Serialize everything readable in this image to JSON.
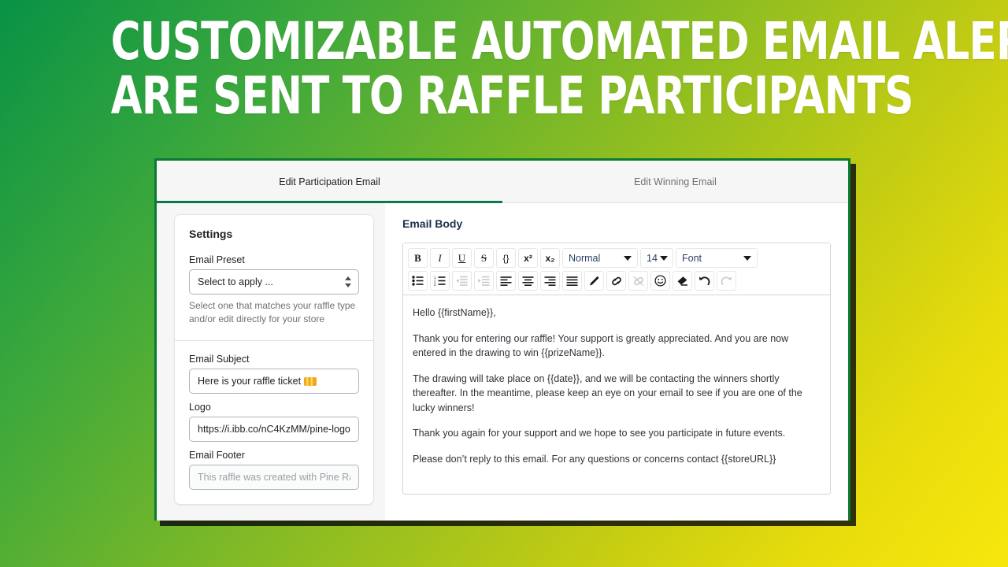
{
  "headline": {
    "line1": "CUSTOMIZABLE AUTOMATED EMAIL ALERTS",
    "line2": "ARE SENT TO RAFFLE PARTICIPANTS"
  },
  "theme": {
    "gradient_start": "#089245",
    "gradient_mid": "#86bb24",
    "gradient_end": "#f7e70d",
    "window_border": "#0b7a33",
    "tab_accent": "#0b7a4a",
    "text_primary": "#202223",
    "text_muted": "#6d7175"
  },
  "tabs": [
    {
      "label": "Edit Participation Email",
      "active": true
    },
    {
      "label": "Edit Winning Email",
      "active": false
    }
  ],
  "settings": {
    "title": "Settings",
    "email_preset": {
      "label": "Email Preset",
      "value": "Select to apply ...",
      "help": "Select one that matches your raffle type and/or edit directly for your store",
      "chevrons_icon": "select-chevrons-icon"
    },
    "email_subject": {
      "label": "Email Subject",
      "value": "Here is your raffle ticket",
      "emoji_icon": "ticket-emoji-icon"
    },
    "logo": {
      "label": "Logo",
      "value": "https://i.ibb.co/nC4KzMM/pine-logo"
    },
    "email_footer": {
      "label": "Email Footer",
      "placeholder": "This raffle was created with Pine Raf"
    }
  },
  "editor": {
    "title": "Email Body",
    "toolbar": {
      "row1": [
        {
          "name": "bold-button",
          "label": "B",
          "style": "bold",
          "dim": false
        },
        {
          "name": "italic-button",
          "label": "I",
          "style": "italic",
          "dim": false
        },
        {
          "name": "underline-button",
          "label": "U",
          "style": "underline",
          "dim": false
        },
        {
          "name": "strikethrough-button",
          "label": "S",
          "style": "strike",
          "dim": false
        },
        {
          "name": "code-block-button",
          "label": "{}",
          "style": "mono",
          "dim": false
        },
        {
          "name": "superscript-button",
          "label": "x²",
          "style": "mono",
          "dim": false
        },
        {
          "name": "subscript-button",
          "label": "x₂",
          "style": "mono",
          "dim": false
        }
      ],
      "heading_select": {
        "name": "heading-select",
        "value": "Normal",
        "caret_icon": "caret-down-icon"
      },
      "font_size_select": {
        "name": "font-size-select",
        "value": "14",
        "caret_icon": "caret-down-icon"
      },
      "font_family_select": {
        "name": "font-family-select",
        "value": "Font",
        "caret_icon": "caret-down-icon"
      },
      "row2": [
        {
          "name": "bullet-list-button",
          "icon": "bullet-list-icon",
          "dim": false
        },
        {
          "name": "numbered-list-button",
          "icon": "numbered-list-icon",
          "dim": false
        },
        {
          "name": "outdent-button",
          "icon": "outdent-icon",
          "dim": true
        },
        {
          "name": "indent-button",
          "icon": "indent-icon",
          "dim": true
        },
        {
          "name": "align-left-button",
          "icon": "align-left-icon",
          "dim": false
        },
        {
          "name": "align-center-button",
          "icon": "align-center-icon",
          "dim": false
        },
        {
          "name": "align-right-button",
          "icon": "align-right-icon",
          "dim": false
        },
        {
          "name": "align-justify-button",
          "icon": "align-justify-icon",
          "dim": false
        },
        {
          "name": "text-color-button",
          "icon": "pen-icon",
          "dim": false
        },
        {
          "name": "insert-link-button",
          "icon": "link-icon",
          "dim": false
        },
        {
          "name": "remove-link-button",
          "icon": "unlink-icon",
          "dim": true
        },
        {
          "name": "emoji-button",
          "icon": "smiley-icon",
          "dim": false
        },
        {
          "name": "clear-format-button",
          "icon": "eraser-icon",
          "dim": false
        },
        {
          "name": "undo-button",
          "icon": "undo-icon",
          "dim": false
        },
        {
          "name": "redo-button",
          "icon": "redo-icon",
          "dim": true
        }
      ]
    },
    "body_paragraphs": [
      "Hello {{firstName}},",
      "Thank you for entering our raffle! Your support is greatly appreciated. And you are now entered in the drawing to win {{prizeName}}.",
      "The drawing will take place on {{date}}, and we will be contacting the winners shortly thereafter. In the meantime, please keep an eye on your email to see if you are one of the lucky winners!",
      "Thank you again for your support and we hope to see you participate in future events.",
      "Please don’t reply to this email. For any questions or concerns contact {{storeURL}}"
    ]
  }
}
